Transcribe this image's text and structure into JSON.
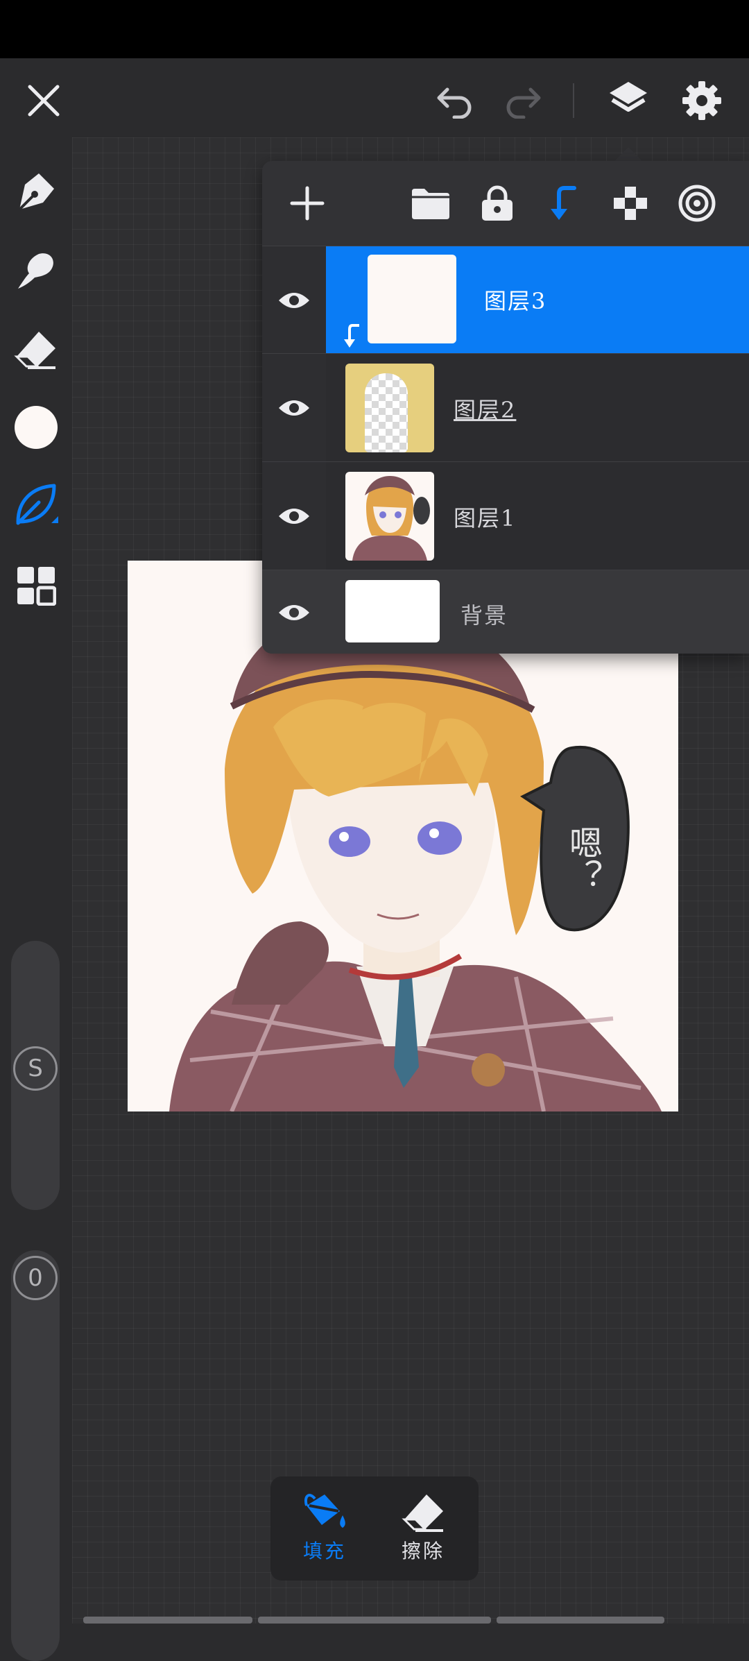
{
  "app": {
    "layers": [
      {
        "name": "图层3",
        "selected": true,
        "clipped": true,
        "visible": true
      },
      {
        "name": "图层2",
        "selected": false,
        "clipped": false,
        "visible": true
      },
      {
        "name": "图层1",
        "selected": false,
        "clipped": false,
        "visible": true
      },
      {
        "name": "背景",
        "selected": false,
        "clipped": false,
        "visible": true
      }
    ],
    "fill_tools": {
      "fill_label": "填充",
      "erase_label": "擦除",
      "active": "fill"
    },
    "sliders": {
      "size_label": "S",
      "opacity_label": "0"
    },
    "artwork": {
      "speech_text": "嗯？"
    }
  },
  "colors": {
    "accent": "#0a7cf5",
    "background": "#2b2b2d",
    "panel": "#323235",
    "current_color": "#fdf8f5"
  },
  "icons": [
    "close-icon",
    "undo-icon",
    "redo-icon",
    "layers-icon",
    "settings-icon",
    "pen-icon",
    "smudge-icon",
    "eraser-icon",
    "color-swatch",
    "leaf-brush-icon",
    "grid-icon",
    "add-layer-icon",
    "folder-icon",
    "lock-icon",
    "clip-icon",
    "checker-icon",
    "target-icon",
    "eye-icon",
    "fill-bucket-icon"
  ]
}
